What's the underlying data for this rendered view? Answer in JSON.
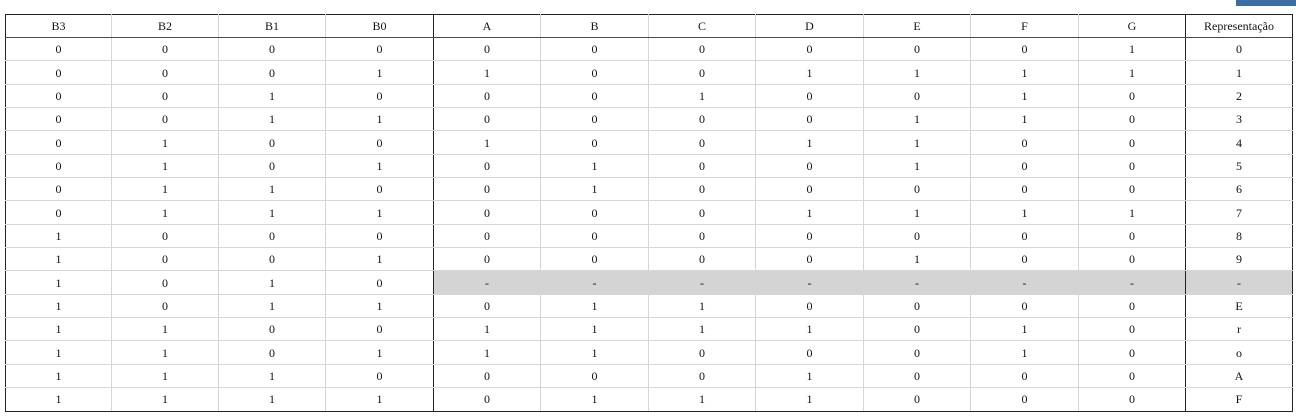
{
  "table": {
    "headers": [
      "B3",
      "B2",
      "B1",
      "B0",
      "A",
      "B",
      "C",
      "D",
      "E",
      "F",
      "G",
      "Representação"
    ],
    "rows": [
      [
        "0",
        "0",
        "0",
        "0",
        "0",
        "0",
        "0",
        "0",
        "0",
        "0",
        "1",
        "0"
      ],
      [
        "0",
        "0",
        "0",
        "1",
        "1",
        "0",
        "0",
        "1",
        "1",
        "1",
        "1",
        "1"
      ],
      [
        "0",
        "0",
        "1",
        "0",
        "0",
        "0",
        "1",
        "0",
        "0",
        "1",
        "0",
        "2"
      ],
      [
        "0",
        "0",
        "1",
        "1",
        "0",
        "0",
        "0",
        "0",
        "1",
        "1",
        "0",
        "3"
      ],
      [
        "0",
        "1",
        "0",
        "0",
        "1",
        "0",
        "0",
        "1",
        "1",
        "0",
        "0",
        "4"
      ],
      [
        "0",
        "1",
        "0",
        "1",
        "0",
        "1",
        "0",
        "0",
        "1",
        "0",
        "0",
        "5"
      ],
      [
        "0",
        "1",
        "1",
        "0",
        "0",
        "1",
        "0",
        "0",
        "0",
        "0",
        "0",
        "6"
      ],
      [
        "0",
        "1",
        "1",
        "1",
        "0",
        "0",
        "0",
        "1",
        "1",
        "1",
        "1",
        "7"
      ],
      [
        "1",
        "0",
        "0",
        "0",
        "0",
        "0",
        "0",
        "0",
        "0",
        "0",
        "0",
        "8"
      ],
      [
        "1",
        "0",
        "0",
        "1",
        "0",
        "0",
        "0",
        "0",
        "1",
        "0",
        "0",
        "9"
      ],
      [
        "1",
        "0",
        "1",
        "0",
        "-",
        "-",
        "-",
        "-",
        "-",
        "-",
        "-",
        "-"
      ],
      [
        "1",
        "0",
        "1",
        "1",
        "0",
        "1",
        "1",
        "0",
        "0",
        "0",
        "0",
        "E"
      ],
      [
        "1",
        "1",
        "0",
        "0",
        "1",
        "1",
        "1",
        "1",
        "0",
        "1",
        "0",
        "r"
      ],
      [
        "1",
        "1",
        "0",
        "1",
        "1",
        "1",
        "0",
        "0",
        "0",
        "1",
        "0",
        "o"
      ],
      [
        "1",
        "1",
        "1",
        "0",
        "0",
        "0",
        "0",
        "1",
        "0",
        "0",
        "0",
        "A"
      ],
      [
        "1",
        "1",
        "1",
        "1",
        "0",
        "1",
        "1",
        "1",
        "0",
        "0",
        "0",
        "F"
      ]
    ],
    "highlighted_row_index": 10,
    "highlight_color": "#d4d4d4"
  }
}
